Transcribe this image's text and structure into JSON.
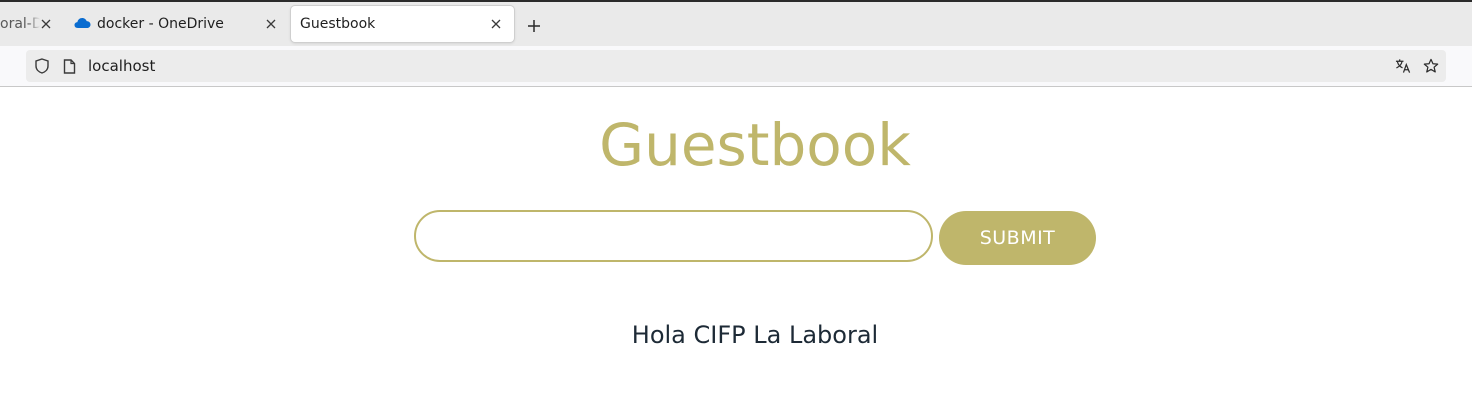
{
  "browser": {
    "tabs": [
      {
        "label": "oral-DA",
        "active": false,
        "partial": true
      },
      {
        "label": "docker - OneDrive",
        "active": false,
        "icon": "onedrive-cloud-icon"
      },
      {
        "label": "Guestbook",
        "active": true
      }
    ],
    "new_tab_label": "+",
    "url": "localhost"
  },
  "page": {
    "title": "Guestbook",
    "input_value": "",
    "submit_label": "SUBMIT",
    "entries": [
      "Hola CIFP La Laboral"
    ]
  },
  "colors": {
    "accent": "#bfb66b",
    "text": "#1d2a36",
    "onedrive_blue": "#0a6cd0"
  }
}
